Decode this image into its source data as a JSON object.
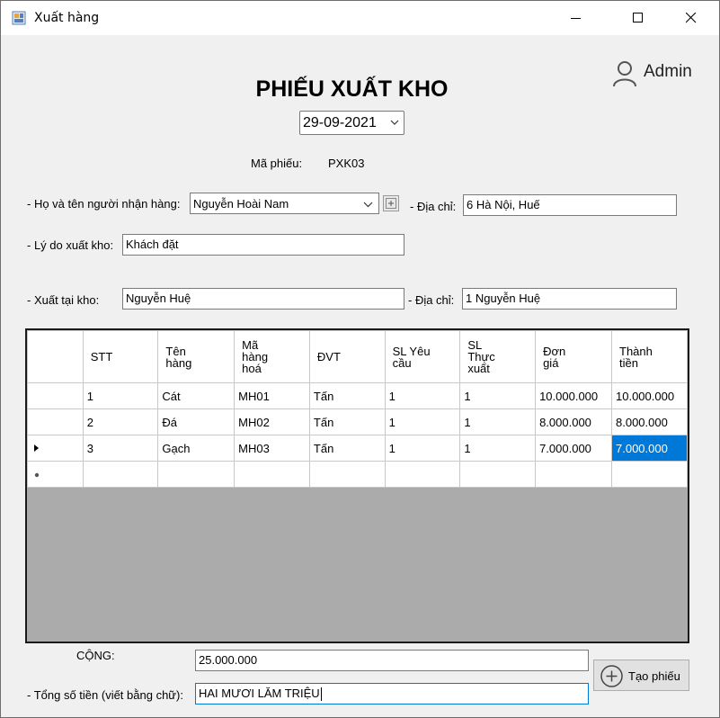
{
  "window": {
    "title": "Xuất hàng",
    "user": "Admin"
  },
  "form": {
    "heading": "PHIẾU XUẤT KHO",
    "date": "29-09-2021",
    "code_label": "Mã phiếu:",
    "code_value": "PXK03",
    "receiver_label": "- Họ và tên người nhận hàng:",
    "receiver_value": "Nguyễn Hoài Nam",
    "receiver_address_label": "- Địa chỉ:",
    "receiver_address_value": "6 Hà Nội, Huế",
    "reason_label": "- Lý do xuất kho:",
    "reason_value": "Khách đặt",
    "warehouse_label": "- Xuất tại kho:",
    "warehouse_value": "Nguyễn Huệ",
    "warehouse_address_label": "- Địa chỉ:",
    "warehouse_address_value": "1 Nguyễn Huệ"
  },
  "grid": {
    "columns": [
      "STT",
      "Tên\nhàng",
      "Mã\nhàng\nhoá",
      "ĐVT",
      "SL Yêu\ncầu",
      "SL\nThực\nxuất",
      "Đơn\ngiá",
      "Thành\ntiền"
    ],
    "rows": [
      [
        "1",
        "Cát",
        "MH01",
        "Tấn",
        "1",
        "1",
        "10.000.000",
        "10.000.000"
      ],
      [
        "2",
        "Đá",
        "MH02",
        "Tấn",
        "1",
        "1",
        "8.000.000",
        "8.000.000"
      ],
      [
        "3",
        "Gạch",
        "MH03",
        "Tấn",
        "1",
        "1",
        "7.000.000",
        "7.000.000"
      ]
    ],
    "current_row": 2,
    "selected_cell": [
      2,
      7
    ]
  },
  "totals": {
    "sum_label": "CỘNG:",
    "sum_value": "25.000.000",
    "words_label": "- Tổng số tiền (viết bằng chữ):",
    "words_value": "HAI MƯƠI LĂM TRIỆU"
  },
  "actions": {
    "create_label": "Tạo phiếu"
  },
  "colors": {
    "selection": "#0078d7",
    "window_bg": "#f0f0f0",
    "grid_bg": "#ababab"
  }
}
